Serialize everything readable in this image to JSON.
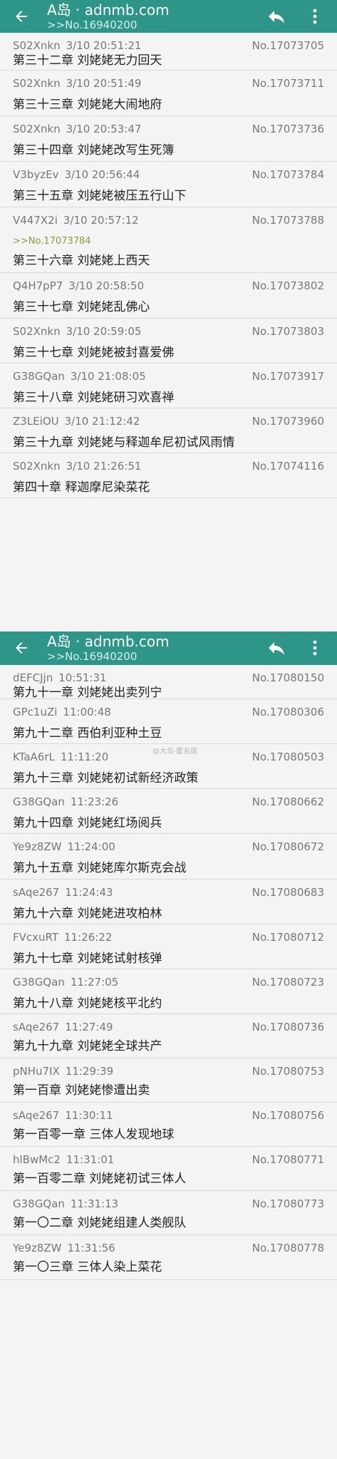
{
  "header": {
    "title": "A岛 · adnmb.com",
    "subtitle": ">>No.16940200"
  },
  "header2": {
    "title": "A岛 · adnmb.com",
    "subtitle": ">>No.16940200"
  },
  "watermark": "@大岛·匿名版",
  "posts_top": [
    {
      "user": "S02Xnkn",
      "time": "3/10 20:51:21",
      "no": "No.17073705",
      "content": "第三十二章 刘姥姥无力回天"
    },
    {
      "user": "S02Xnkn",
      "time": "3/10 20:51:49",
      "no": "No.17073711",
      "content": "第三十三章 刘姥姥大闹地府"
    },
    {
      "user": "S02Xnkn",
      "time": "3/10 20:53:47",
      "no": "No.17073736",
      "content": "第三十四章 刘姥姥改写生死簿"
    },
    {
      "user": "V3byzEv",
      "time": "3/10 20:56:44",
      "no": "No.17073784",
      "content": "第三十五章 刘姥姥被压五行山下"
    },
    {
      "user": "V447X2i",
      "time": "3/10 20:57:12",
      "no": "No.17073788",
      "quote": ">>No.17073784",
      "content": "第三十六章 刘姥姥上西天"
    },
    {
      "user": "Q4H7pP7",
      "time": "3/10 20:58:50",
      "no": "No.17073802",
      "content": "第三十七章 刘姥姥乱佛心"
    },
    {
      "user": "S02Xnkn",
      "time": "3/10 20:59:05",
      "no": "No.17073803",
      "content": "第三十七章 刘姥姥被封喜爱佛"
    },
    {
      "user": "G38GQan",
      "time": "3/10 21:08:05",
      "no": "No.17073917",
      "content": "第三十八章 刘姥姥研习欢喜禅"
    },
    {
      "user": "Z3LEiOU",
      "time": "3/10 21:12:42",
      "no": "No.17073960",
      "content": "第三十九章 刘姥姥与释迦牟尼初试风雨情"
    },
    {
      "user": "S02Xnkn",
      "time": "3/10 21:26:51",
      "no": "No.17074116",
      "content": "第四十章 释迦摩尼染菜花"
    }
  ],
  "posts_bottom": [
    {
      "user": "dEFCJjn",
      "time": "10:51:31",
      "no": "No.17080150",
      "content": "第九十一章 刘姥姥出卖列宁"
    },
    {
      "user": "GPc1uZi",
      "time": "11:00:48",
      "no": "No.17080306",
      "content": "第九十二章 西伯利亚种土豆"
    },
    {
      "user": "KTaA6rL",
      "time": "11:11:20",
      "no": "No.17080503",
      "content": "第九十三章 刘姥姥初试新经济政策"
    },
    {
      "user": "G38GQan",
      "time": "11:23:26",
      "no": "No.17080662",
      "content": "第九十四章 刘姥姥红场阅兵"
    },
    {
      "user": "Ye9z8ZW",
      "time": "11:24:00",
      "no": "No.17080672",
      "content": "第九十五章 刘姥姥库尔斯克会战"
    },
    {
      "user": "sAqe267",
      "time": "11:24:43",
      "no": "No.17080683",
      "content": "第九十六章 刘姥姥进攻柏林"
    },
    {
      "user": "FVcxuRT",
      "time": "11:26:22",
      "no": "No.17080712",
      "content": "第九十七章 刘姥姥试射核弹"
    },
    {
      "user": "G38GQan",
      "time": "11:27:05",
      "no": "No.17080723",
      "content": "第九十八章 刘姥姥核平北约"
    },
    {
      "user": "sAqe267",
      "time": "11:27:49",
      "no": "No.17080736",
      "content": "第九十九章 刘姥姥全球共产"
    },
    {
      "user": "pNHu7IX",
      "time": "11:29:39",
      "no": "No.17080753",
      "content": "第一百章 刘姥姥惨遭出卖"
    },
    {
      "user": "sAqe267",
      "time": "11:30:11",
      "no": "No.17080756",
      "content": "第一百零一章 三体人发现地球"
    },
    {
      "user": "hlBwMc2",
      "time": "11:31:01",
      "no": "No.17080771",
      "content": "第一百零二章 刘姥姥初试三体人"
    },
    {
      "user": "G38GQan",
      "time": "11:31:13",
      "no": "No.17080773",
      "content": "第一〇二章 刘姥姥组建人类舰队"
    },
    {
      "user": "Ye9z8ZW",
      "time": "11:31:56",
      "no": "No.17080778",
      "content": "第一〇三章 三体人染上菜花"
    }
  ]
}
